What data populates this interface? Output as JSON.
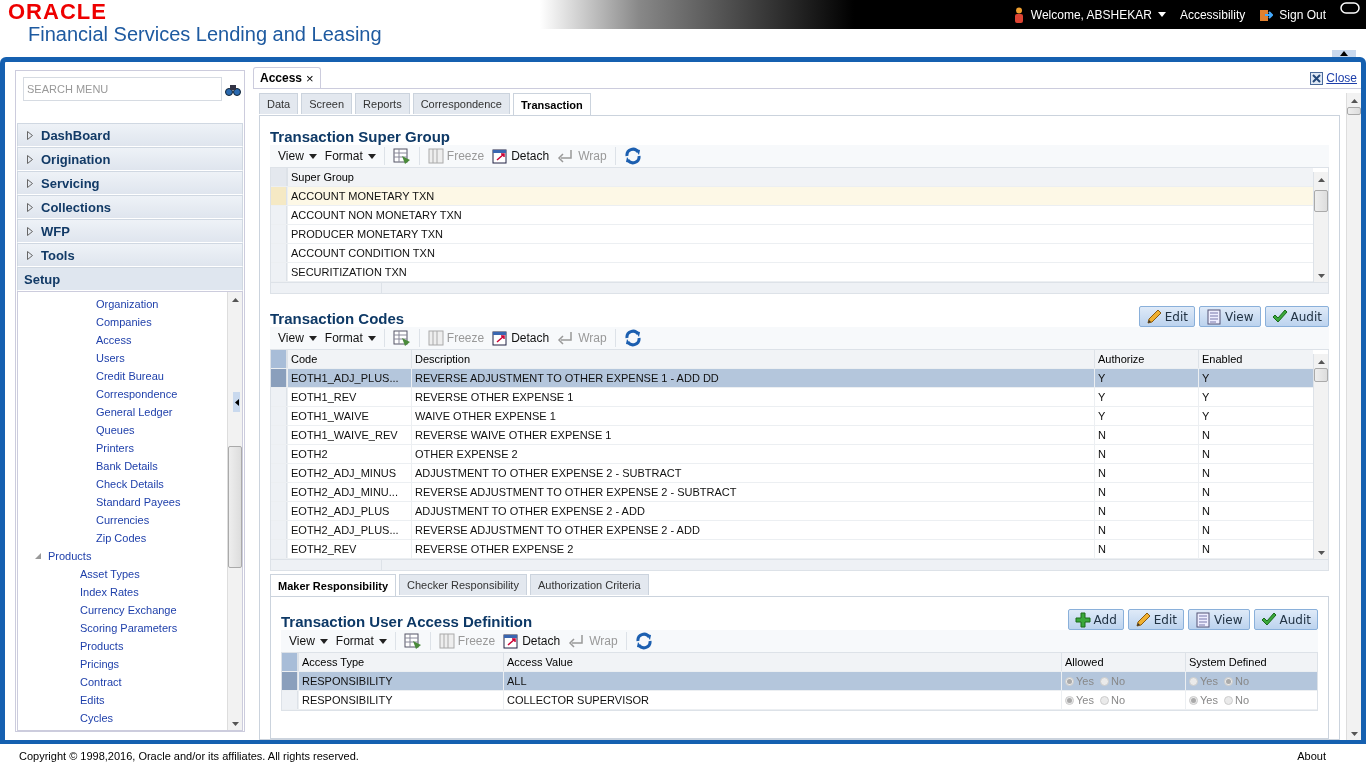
{
  "header": {
    "brand": "ORACLE",
    "product": "Financial Services Lending and Leasing",
    "welcome": "Welcome, ABSHEKAR",
    "links": [
      {
        "label": "Accessibility",
        "kind": "plain"
      },
      {
        "label": "Sign Out",
        "kind": "signout"
      }
    ]
  },
  "sidebar": {
    "search": {
      "placeholder": "SEARCH MENU"
    },
    "sections": [
      {
        "label": "DashBoard",
        "expanded": false
      },
      {
        "label": "Origination",
        "expanded": false
      },
      {
        "label": "Servicing",
        "expanded": false
      },
      {
        "label": "Collections",
        "expanded": false
      },
      {
        "label": "WFP",
        "expanded": false
      },
      {
        "label": "Tools",
        "expanded": false
      },
      {
        "label": "Setup",
        "expanded": true
      }
    ],
    "tree": [
      {
        "children": [
          {
            "label": "Organization"
          },
          {
            "label": "Companies"
          },
          {
            "label": "Access"
          },
          {
            "label": "Users"
          },
          {
            "label": "Credit Bureau"
          },
          {
            "label": "Correspondence"
          },
          {
            "label": "General Ledger"
          },
          {
            "label": "Queues"
          },
          {
            "label": "Printers"
          },
          {
            "label": "Bank Details"
          },
          {
            "label": "Check Details"
          },
          {
            "label": "Standard Payees"
          },
          {
            "label": "Currencies"
          },
          {
            "label": "Zip Codes"
          }
        ]
      },
      {
        "label": "Products",
        "expanded": true,
        "children": [
          {
            "label": "Asset Types"
          },
          {
            "label": "Index Rates"
          },
          {
            "label": "Currency Exchange"
          },
          {
            "label": "Scoring Parameters"
          },
          {
            "label": "Products"
          },
          {
            "label": "Pricings"
          },
          {
            "label": "Contract"
          },
          {
            "label": "Edits"
          },
          {
            "label": "Cycles"
          }
        ]
      }
    ]
  },
  "page_tab": {
    "label": "Access",
    "close": "×"
  },
  "close_link": "Close",
  "tabs": [
    {
      "label": "Data",
      "selected": false
    },
    {
      "label": "Screen",
      "selected": false
    },
    {
      "label": "Reports",
      "selected": false
    },
    {
      "label": "Correspondence",
      "selected": false
    },
    {
      "label": "Transaction",
      "selected": true
    }
  ],
  "super_group": {
    "title": "Transaction Super Group",
    "toolbar": [
      {
        "kind": "menu",
        "label": "View"
      },
      {
        "kind": "menu",
        "label": "Format"
      },
      {
        "kind": "export"
      },
      {
        "kind": "freeze",
        "label": "Freeze",
        "disabled": true
      },
      {
        "kind": "detach",
        "label": "Detach",
        "disabled": false
      },
      {
        "kind": "wrap",
        "label": "Wrap",
        "disabled": true
      },
      {
        "kind": "refresh"
      }
    ],
    "columns": [
      "Super Group"
    ],
    "rows": [
      {
        "cells": [
          "ACCOUNT MONETARY TXN"
        ],
        "selected": true
      },
      {
        "cells": [
          "ACCOUNT NON MONETARY TXN"
        ],
        "selected": false
      },
      {
        "cells": [
          "PRODUCER MONETARY TXN"
        ],
        "selected": false
      },
      {
        "cells": [
          "ACCOUNT CONDITION TXN"
        ],
        "selected": false
      },
      {
        "cells": [
          "SECURITIZATION TXN"
        ],
        "selected": false
      }
    ]
  },
  "codes": {
    "title": "Transaction Codes",
    "buttons": [
      {
        "kind": "edit",
        "label": "Edit"
      },
      {
        "kind": "view",
        "label": "View"
      },
      {
        "kind": "audit",
        "label": "Audit"
      }
    ],
    "toolbar": [
      {
        "kind": "menu",
        "label": "View"
      },
      {
        "kind": "menu",
        "label": "Format"
      },
      {
        "kind": "export"
      },
      {
        "kind": "freeze",
        "label": "Freeze",
        "disabled": true
      },
      {
        "kind": "detach",
        "label": "Detach",
        "disabled": false
      },
      {
        "kind": "wrap",
        "label": "Wrap",
        "disabled": true
      },
      {
        "kind": "refresh"
      }
    ],
    "columns": [
      "Code",
      "Description",
      "Authorize",
      "Enabled"
    ],
    "rows": [
      {
        "cells": [
          "EOTH1_ADJ_PLUS...",
          "REVERSE ADJUSTMENT TO OTHER EXPENSE 1 - ADD DD",
          "Y",
          "Y"
        ],
        "selected": true
      },
      {
        "cells": [
          "EOTH1_REV",
          "REVERSE OTHER EXPENSE 1",
          "Y",
          "Y"
        ],
        "selected": false
      },
      {
        "cells": [
          "EOTH1_WAIVE",
          "WAIVE OTHER EXPENSE 1",
          "Y",
          "Y"
        ],
        "selected": false
      },
      {
        "cells": [
          "EOTH1_WAIVE_REV",
          "REVERSE WAIVE OTHER EXPENSE 1",
          "N",
          "N"
        ],
        "selected": false
      },
      {
        "cells": [
          "EOTH2",
          "OTHER EXPENSE 2",
          "N",
          "N"
        ],
        "selected": false
      },
      {
        "cells": [
          "EOTH2_ADJ_MINUS",
          "ADJUSTMENT TO OTHER EXPENSE 2 - SUBTRACT",
          "N",
          "N"
        ],
        "selected": false
      },
      {
        "cells": [
          "EOTH2_ADJ_MINU...",
          "REVERSE ADJUSTMENT TO OTHER EXPENSE 2 - SUBTRACT",
          "N",
          "N"
        ],
        "selected": false
      },
      {
        "cells": [
          "EOTH2_ADJ_PLUS",
          "ADJUSTMENT TO OTHER EXPENSE 2 - ADD",
          "N",
          "N"
        ],
        "selected": false
      },
      {
        "cells": [
          "EOTH2_ADJ_PLUS...",
          "REVERSE ADJUSTMENT TO OTHER EXPENSE 2 - ADD",
          "N",
          "N"
        ],
        "selected": false
      },
      {
        "cells": [
          "EOTH2_REV",
          "REVERSE OTHER EXPENSE 2",
          "N",
          "N"
        ],
        "selected": false
      }
    ]
  },
  "sub_tabs": [
    {
      "label": "Maker Responsibility",
      "selected": true
    },
    {
      "label": "Checker Responsibility",
      "selected": false
    },
    {
      "label": "Authorization Criteria",
      "selected": false
    }
  ],
  "user_access": {
    "title": "Transaction User Access Definition",
    "buttons": [
      {
        "kind": "add",
        "label": "Add"
      },
      {
        "kind": "edit",
        "label": "Edit"
      },
      {
        "kind": "view",
        "label": "View"
      },
      {
        "kind": "audit",
        "label": "Audit"
      }
    ],
    "toolbar": [
      {
        "kind": "menu",
        "label": "View"
      },
      {
        "kind": "menu",
        "label": "Format"
      },
      {
        "kind": "export"
      },
      {
        "kind": "freeze",
        "label": "Freeze",
        "disabled": true
      },
      {
        "kind": "detach",
        "label": "Detach",
        "disabled": false
      },
      {
        "kind": "wrap",
        "label": "Wrap",
        "disabled": true
      },
      {
        "kind": "refresh"
      }
    ],
    "columns": [
      "Access Type",
      "Access Value",
      "Allowed",
      "System Defined"
    ],
    "rows": [
      {
        "cells": [
          "RESPONSIBILITY",
          "ALL",
          {
            "disabled": true,
            "options": [
              {
                "label": "Yes",
                "selected": true
              },
              {
                "label": "No",
                "selected": false
              }
            ]
          },
          {
            "disabled": true,
            "options": [
              {
                "label": "Yes",
                "selected": false
              },
              {
                "label": "No",
                "selected": true
              }
            ]
          }
        ],
        "selected": true
      },
      {
        "cells": [
          "RESPONSIBILITY",
          "COLLECTOR SUPERVISOR",
          {
            "disabled": true,
            "options": [
              {
                "label": "Yes",
                "selected": true
              },
              {
                "label": "No",
                "selected": false
              }
            ]
          },
          {
            "disabled": true,
            "options": [
              {
                "label": "Yes",
                "selected": true
              },
              {
                "label": "No",
                "selected": false
              }
            ]
          }
        ],
        "selected": false
      }
    ]
  },
  "footer": {
    "copyright": "Copyright © 1998,2016, Oracle and/or its affiliates. All rights reserved.",
    "about": "About"
  }
}
